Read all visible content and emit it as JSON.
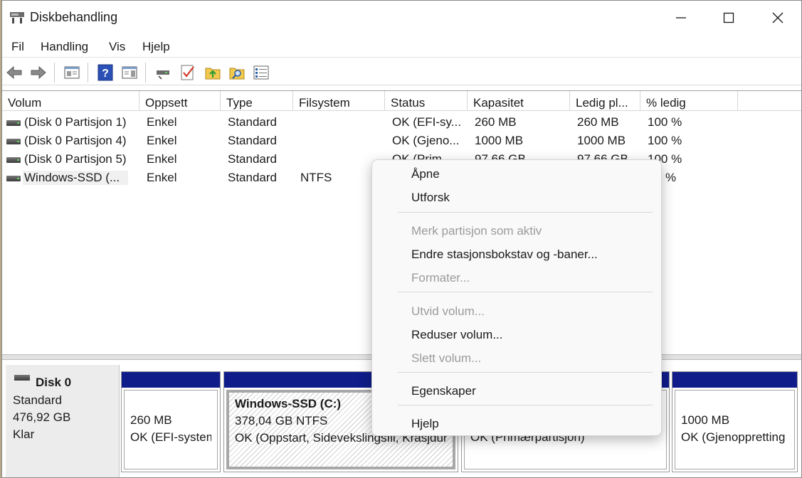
{
  "window": {
    "title": "Diskbehandling",
    "app_icon": "disk-management-icon"
  },
  "titlebar_buttons": [
    "minimize-icon",
    "maximize-icon",
    "close-icon"
  ],
  "menu": [
    "Fil",
    "Handling",
    "Vis",
    "Hjelp"
  ],
  "toolbar_icons": [
    "back-arrow-icon",
    "forward-arrow-icon",
    "console-tree-icon",
    "help-icon",
    "show-hide-pane-icon",
    "connect-drive-icon",
    "check-icon",
    "folder-up-icon",
    "folder-search-icon",
    "properties-list-icon"
  ],
  "volume_table": {
    "columns": [
      "Volum",
      "Oppsett",
      "Type",
      "Filsystem",
      "Status",
      "Kapasitet",
      "Ledig pl...",
      "% ledig"
    ],
    "rows": [
      [
        "(Disk 0 Partisjon 1)",
        "Enkel",
        "Standard",
        "",
        "OK (EFI-sy...",
        "260 MB",
        "260 MB",
        "100 %"
      ],
      [
        "(Disk 0 Partisjon 4)",
        "Enkel",
        "Standard",
        "",
        "OK (Gjeno...",
        "1000 MB",
        "1000 MB",
        "100 %"
      ],
      [
        "(Disk 0 Partisjon 5)",
        "Enkel",
        "Standard",
        "",
        "OK (Prim...",
        "97,66 GB",
        "97,66 GB",
        "100 %"
      ],
      [
        "Windows-SSD (...",
        "Enkel",
        "Standard",
        "NTFS",
        "",
        "",
        "",
        "%"
      ]
    ]
  },
  "disk": {
    "name": "Disk 0",
    "type": "Standard",
    "size": "476,92 GB",
    "state": "Klar",
    "icon": "disk-drive-icon"
  },
  "partitions": [
    {
      "size": "260 MB",
      "status": "OK (EFI-system"
    },
    {
      "name": "Windows-SSD  (C:)",
      "size": "378,04 GB NTFS",
      "status": "OK (Oppstart, Sidevekslingsfil, Krasjdur"
    },
    {
      "status": "OK (Primærpartisjon)"
    },
    {
      "size": "1000 MB",
      "status": "OK (Gjenoppretting"
    }
  ],
  "context_menu": {
    "open": "Åpne",
    "explore": "Utforsk",
    "mark_active": "Merk partisjon som aktiv",
    "change_letter": "Endre stasjonsbokstav og -baner...",
    "format": "Formater...",
    "extend": "Utvid volum...",
    "shrink": "Reduser volum...",
    "delete": "Slett volum...",
    "properties": "Egenskaper",
    "help": "Hjelp"
  }
}
